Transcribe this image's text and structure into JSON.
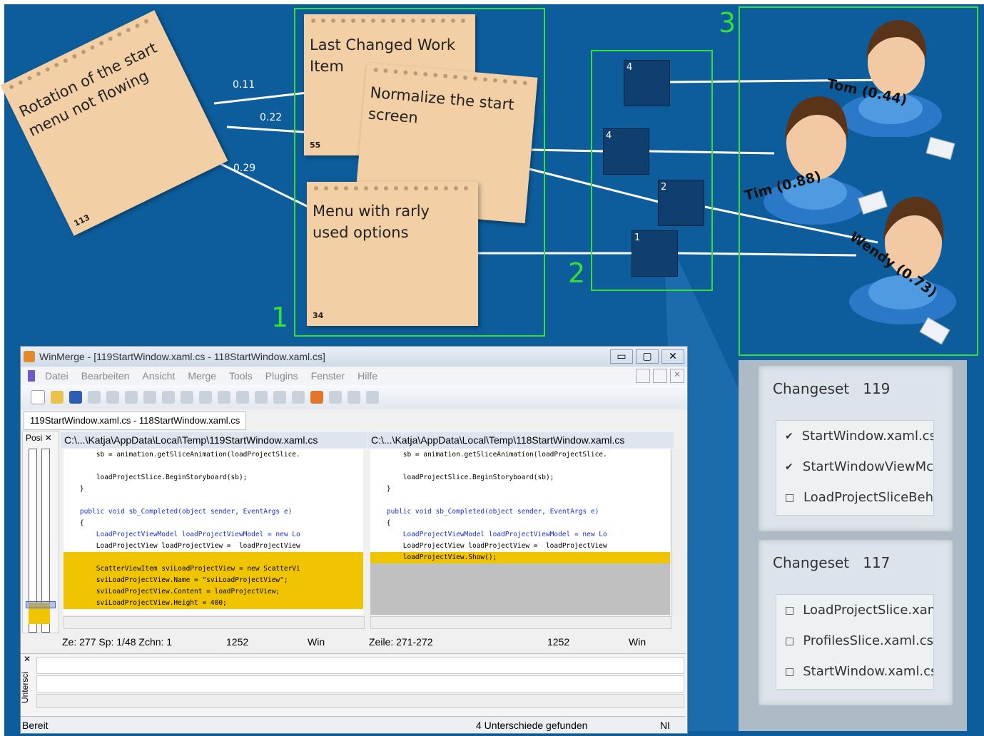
{
  "notes": {
    "rotation": {
      "title": "Rotation of the start menu not flowing",
      "count": "113"
    },
    "last_changed": {
      "title": "Last Changed Work Item",
      "count": "55"
    },
    "normalize": {
      "title": "Normalize the start screen"
    },
    "menu": {
      "title": "Menu with rarly used options",
      "count": "34"
    }
  },
  "edges": {
    "w1": "0.11",
    "w2": "0.22",
    "w3": "0.29"
  },
  "groups": {
    "g1": "1",
    "g2": "2",
    "g3": "3"
  },
  "changeset_boxes": [
    "4",
    "4",
    "2",
    "1"
  ],
  "people": {
    "tom": "Tom (0.44)",
    "tim": "Tim (0.88)",
    "wendy": "Wendy (0.73)"
  },
  "winmerge": {
    "title": "WinMerge - [119StartWindow.xaml.cs - 118StartWindow.xaml.cs]",
    "menu": [
      "Datei",
      "Bearbeiten",
      "Ansicht",
      "Merge",
      "Tools",
      "Plugins",
      "Fenster",
      "Hilfe"
    ],
    "tab": "119StartWindow.xaml.cs - 118StartWindow.xaml.cs",
    "location_pane": "Posi",
    "left_path": "C:\\...\\Katja\\AppData\\Local\\Temp\\119StartWindow.xaml.cs",
    "right_path": "C:\\...\\Katja\\AppData\\Local\\Temp\\118StartWindow.xaml.cs",
    "left_code": [
      "        sb = animation.getSliceAnimation(loadProjectSlice.",
      "",
      "        loadProjectSlice.BeginStoryboard(sb);",
      "    }",
      "",
      "    public void sb_Completed(object sender, EventArgs e)",
      "    {",
      "        LoadProjectViewModel loadProjectViewModel = new Lo",
      "        LoadProjectView loadProjectView =  loadProjectView",
      "",
      "        ScatterViewItem sviLoadProjectView = new ScatterVi",
      "        sviLoadProjectView.Name = \"sviLoadProjectView\";",
      "        sviLoadProjectView.Content = loadProjectView;",
      "        sviLoadProjectView.Height = 400;"
    ],
    "right_code": [
      "        sb = animation.getSliceAnimation(loadProjectSlice.",
      "",
      "        loadProjectSlice.BeginStoryboard(sb);",
      "    }",
      "",
      "    public void sb_Completed(object sender, EventArgs e)",
      "    {",
      "        LoadProjectViewModel loadProjectViewModel = new Lo",
      "        LoadProjectView loadProjectView =  loadProjectView",
      "        loadProjectView.Show();"
    ],
    "status_left": {
      "pos": "Ze: 277  Sp: 1/48  Zchn: 1",
      "size": "1252",
      "eol": "Win"
    },
    "status_right": {
      "pos": "Zeile: 271-272",
      "size": "1252",
      "eol": "Win"
    },
    "diff_pane_label": "Untersci",
    "status_ready": "Bereit",
    "status_diffs": "4 Unterschiede gefunden",
    "status_mode": "NI"
  },
  "changesets": [
    {
      "label": "Changeset",
      "id": "119",
      "files": [
        {
          "name": "StartWindow.xaml.cs",
          "checked": true
        },
        {
          "name": "StartWindowViewMc",
          "checked": true
        },
        {
          "name": "LoadProjectSliceBeh",
          "checked": false
        }
      ]
    },
    {
      "label": "Changeset",
      "id": "117",
      "files": [
        {
          "name": "LoadProjectSlice.xan",
          "checked": false
        },
        {
          "name": "ProfilesSlice.xaml.cs",
          "checked": false
        },
        {
          "name": "StartWindow.xaml.cs",
          "checked": false
        }
      ]
    }
  ],
  "colors": {
    "background": "#0d5d9c",
    "highlight": "#33e033",
    "note": "#f2cfa5",
    "diff": "#f0c500"
  }
}
